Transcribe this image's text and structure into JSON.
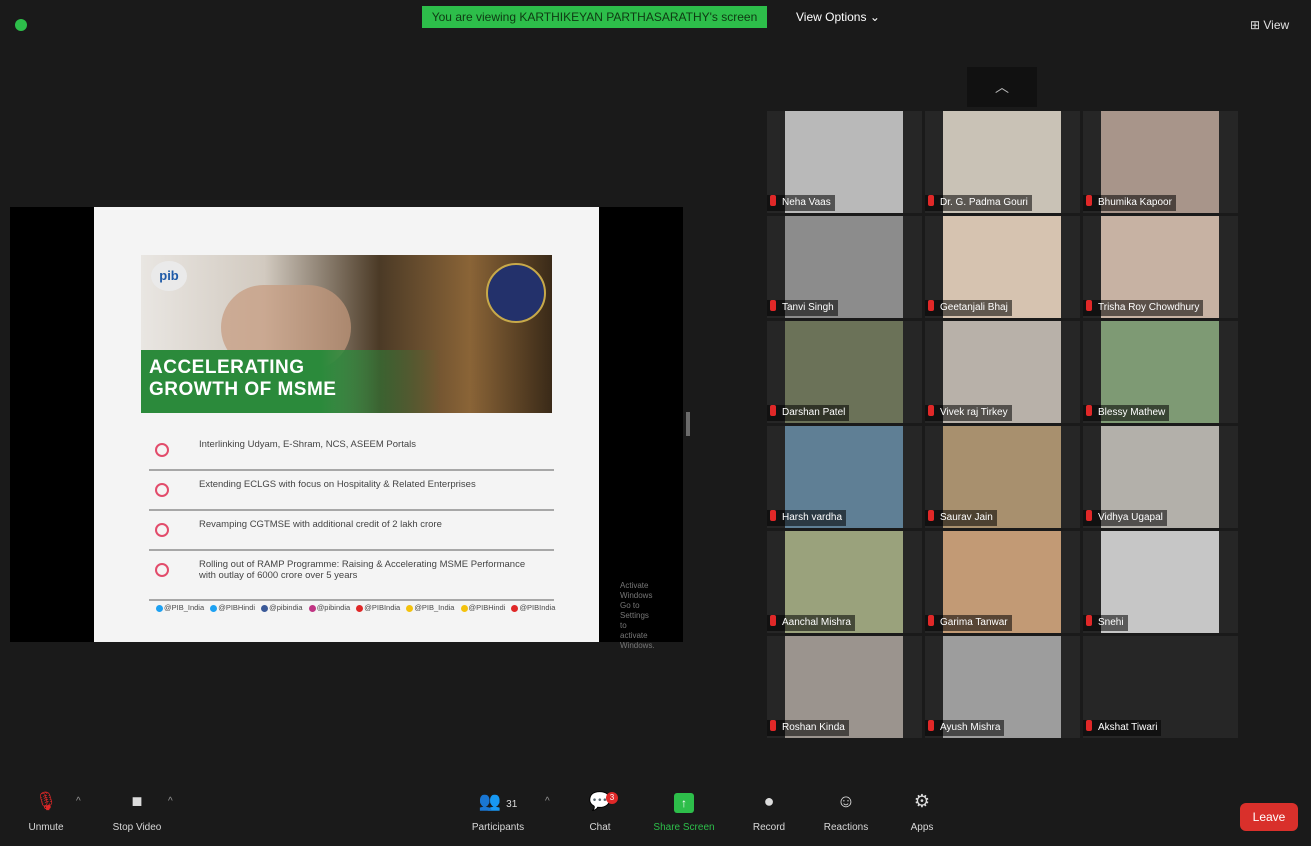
{
  "banner": "You are viewing KARTHIKEYAN PARTHASARATHY's screen",
  "view_options": "View Options",
  "view_options_caret": "⌄",
  "view_button": "⊞ View",
  "slide": {
    "logo": "pib",
    "title_line1": "ACCELERATING",
    "title_line2": "GROWTH OF MSME",
    "bullets": [
      "Interlinking Udyam, E-Shram, NCS, ASEEM Portals",
      "Extending ECLGS with focus on Hospitality & Related Enterprises",
      "Revamping CGTMSE with additional credit of 2 lakh crore",
      "Rolling out of RAMP Programme: Raising & Accelerating MSME Performance with outlay of 6000 crore over 5 years"
    ],
    "social": [
      "@PIB_India",
      "@PIBHindi",
      "@pibindia",
      "@pibindia",
      "@PIBIndia",
      "@PIB_India",
      "@PIBHindi",
      "@PIBIndia"
    ],
    "activate_line1": "Activate Windows",
    "activate_line2": "Go to Settings to activate Windows."
  },
  "participants": [
    {
      "name": "Neha Vaas",
      "bg": "#3a3a3a",
      "vid": "#b9b9b9"
    },
    {
      "name": "Dr. G. Padma Gouri",
      "bg": "#3a3a3a",
      "vid": "#c9c2b6"
    },
    {
      "name": "Bhumika Kapoor",
      "bg": "#3a3a3a",
      "vid": "#a8958a"
    },
    {
      "name": "Tanvi Singh",
      "bg": "#3a3a3a",
      "vid": "#8c8c8c"
    },
    {
      "name": "Geetanjali Bhaj",
      "bg": "#3a3a3a",
      "vid": "#d6c3b0"
    },
    {
      "name": "Trisha Roy Chowdhury",
      "bg": "#3a3a3a",
      "vid": "#c7b2a3"
    },
    {
      "name": "Darshan Patel",
      "bg": "#3a3a3a",
      "vid": "#6b7258"
    },
    {
      "name": "Vivek raj Tirkey",
      "bg": "#3a3a3a",
      "vid": "#b8b1a9"
    },
    {
      "name": "Blessy Mathew",
      "bg": "#3a3a3a",
      "vid": "#7e9a74"
    },
    {
      "name": "Harsh vardha",
      "bg": "#3a3a3a",
      "vid": "#5f7f95"
    },
    {
      "name": "Saurav Jain",
      "bg": "#3a3a3a",
      "vid": "#a8906e"
    },
    {
      "name": "Vidhya Ugapal",
      "bg": "#3a3a3a",
      "vid": "#b3b0aa"
    },
    {
      "name": "Aanchal Mishra",
      "bg": "#3a3a3a",
      "vid": "#9aa27c"
    },
    {
      "name": "Garima Tanwar",
      "bg": "#3a3a3a",
      "vid": "#c29a75"
    },
    {
      "name": "Snehi",
      "bg": "#3a3a3a",
      "vid": "#c6c6c6"
    },
    {
      "name": "Roshan Kinda",
      "bg": "#3a3a3a",
      "vid": "#9b948e"
    },
    {
      "name": "Ayush Mishra",
      "bg": "#3a3a3a",
      "vid": "#9d9d9d"
    },
    {
      "name": "Akshat Tiwari",
      "bg": "#262626",
      "vid": ""
    }
  ],
  "toolbar": {
    "unmute": "Unmute",
    "unmute_icon": "🎙",
    "stop_video": "Stop Video",
    "stop_video_icon": "■",
    "caret": "^",
    "participants": "Participants",
    "participants_icon": "👥",
    "participants_count": "31",
    "chat": "Chat",
    "chat_icon": "💬",
    "chat_badge": "3",
    "share_screen": "Share Screen",
    "share_icon": "↑",
    "record": "Record",
    "record_icon": "●",
    "reactions": "Reactions",
    "reactions_icon": "☺",
    "apps": "Apps",
    "apps_icon": "⚙",
    "leave": "Leave"
  },
  "colors": {
    "accent": "#2dbe4a",
    "leave": "#d9302b",
    "muted": "#e02828"
  }
}
